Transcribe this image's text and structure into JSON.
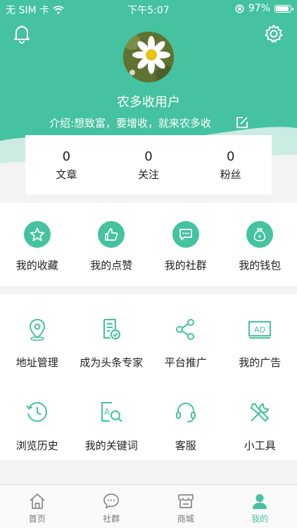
{
  "status_bar": {
    "carrier": "无 SIM 卡",
    "time": "下午5:07",
    "battery_percent": "97%",
    "battery_level": 0.97
  },
  "profile": {
    "username": "农多收用户",
    "bio": "介绍:想致富，要增收，就来农多收"
  },
  "stats": [
    {
      "value": "0",
      "label": "文章"
    },
    {
      "value": "0",
      "label": "关注"
    },
    {
      "value": "0",
      "label": "粉丝"
    }
  ],
  "quick_actions": [
    {
      "label": "我的收藏",
      "icon": "star-icon"
    },
    {
      "label": "我的点赞",
      "icon": "thumbs-up-icon"
    },
    {
      "label": "我的社群",
      "icon": "chat-icon"
    },
    {
      "label": "我的钱包",
      "icon": "money-bag-icon"
    }
  ],
  "services": [
    {
      "label": "地址管理",
      "icon": "location-pin-icon"
    },
    {
      "label": "成为头条专家",
      "icon": "document-check-icon"
    },
    {
      "label": "平台推广",
      "icon": "share-icon"
    },
    {
      "label": "我的广告",
      "icon": "ad-icon"
    },
    {
      "label": "浏览历史",
      "icon": "history-clock-icon"
    },
    {
      "label": "我的关键词",
      "icon": "keyword-search-icon"
    },
    {
      "label": "客服",
      "icon": "headset-icon"
    },
    {
      "label": "小工具",
      "icon": "tools-icon"
    }
  ],
  "tabs": [
    {
      "label": "首页",
      "icon": "home-icon",
      "active": false
    },
    {
      "label": "社群",
      "icon": "community-chat-icon",
      "active": false
    },
    {
      "label": "商城",
      "icon": "shop-icon",
      "active": false
    },
    {
      "label": "我的",
      "icon": "profile-icon",
      "active": true
    }
  ],
  "colors": {
    "accent": "#45c2a0",
    "tab_inactive": "#777777"
  }
}
